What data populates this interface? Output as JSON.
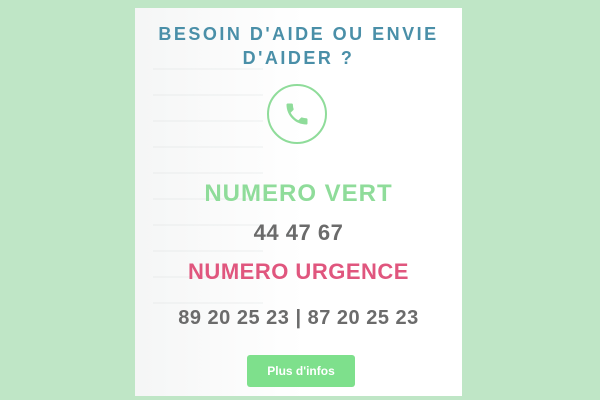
{
  "card": {
    "title_line1": "BESOIN D'AIDE OU ENVIE",
    "title_line2": "D'AIDER ?",
    "icon": "phone-icon",
    "numero_vert_label": "NUMERO VERT",
    "numero_vert_value": "44 47 67",
    "numero_urgence_label": "NUMERO URGENCE",
    "numero_urgence_value": "89 20 25 23 | 87 20 25 23",
    "button_label": "Plus d'infos"
  },
  "colors": {
    "page_background": "#bfe6c6",
    "title": "#4a8fa8",
    "accent_green": "#8fdc9a",
    "button_green": "#7ee08c",
    "urgence_pink": "#e0567e",
    "number_grey": "#6b6b6b"
  }
}
